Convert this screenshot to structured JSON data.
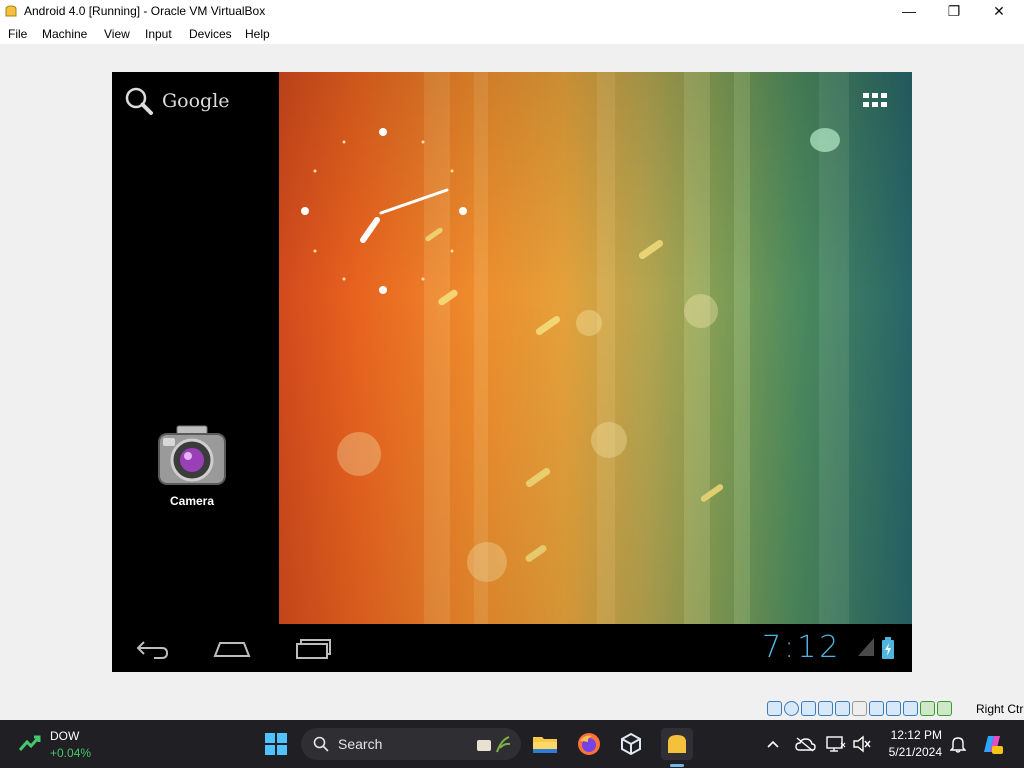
{
  "window": {
    "title": "Android 4.0 [Running] - Oracle VM VirtualBox",
    "minimize_glyph": "—",
    "maximize_glyph": "❐",
    "close_glyph": "✕"
  },
  "menu": [
    "File",
    "Machine",
    "View",
    "Input",
    "Devices",
    "Help"
  ],
  "android": {
    "search_label": "Google",
    "apps": [
      {
        "label": "Camera",
        "icon": "camera-icon"
      }
    ],
    "clock_time": "7:12",
    "nav_buttons": [
      "back-icon",
      "home-icon",
      "recent-apps-icon"
    ],
    "accent": "#4fb4de"
  },
  "vbox_status": {
    "host_key": "Right Ctrl",
    "icons": [
      "hard-disk-icon",
      "optical-drive-icon",
      "audio-icon",
      "network-icon",
      "usb-icon",
      "shared-folders-icon",
      "display-icon",
      "video-capture-icon",
      "cpu-icon",
      "mouse-integration-icon",
      "keyboard-icon"
    ]
  },
  "taskbar": {
    "widget": {
      "label": "DOW",
      "value": "+0.04%"
    },
    "search_placeholder": "Search",
    "pinned": [
      "windows-start-icon",
      "file-explorer-icon",
      "firefox-icon",
      "virtualbox-manager-icon",
      "virtualbox-vm-icon"
    ],
    "time": "12:12 PM",
    "date": "5/21/2024"
  }
}
